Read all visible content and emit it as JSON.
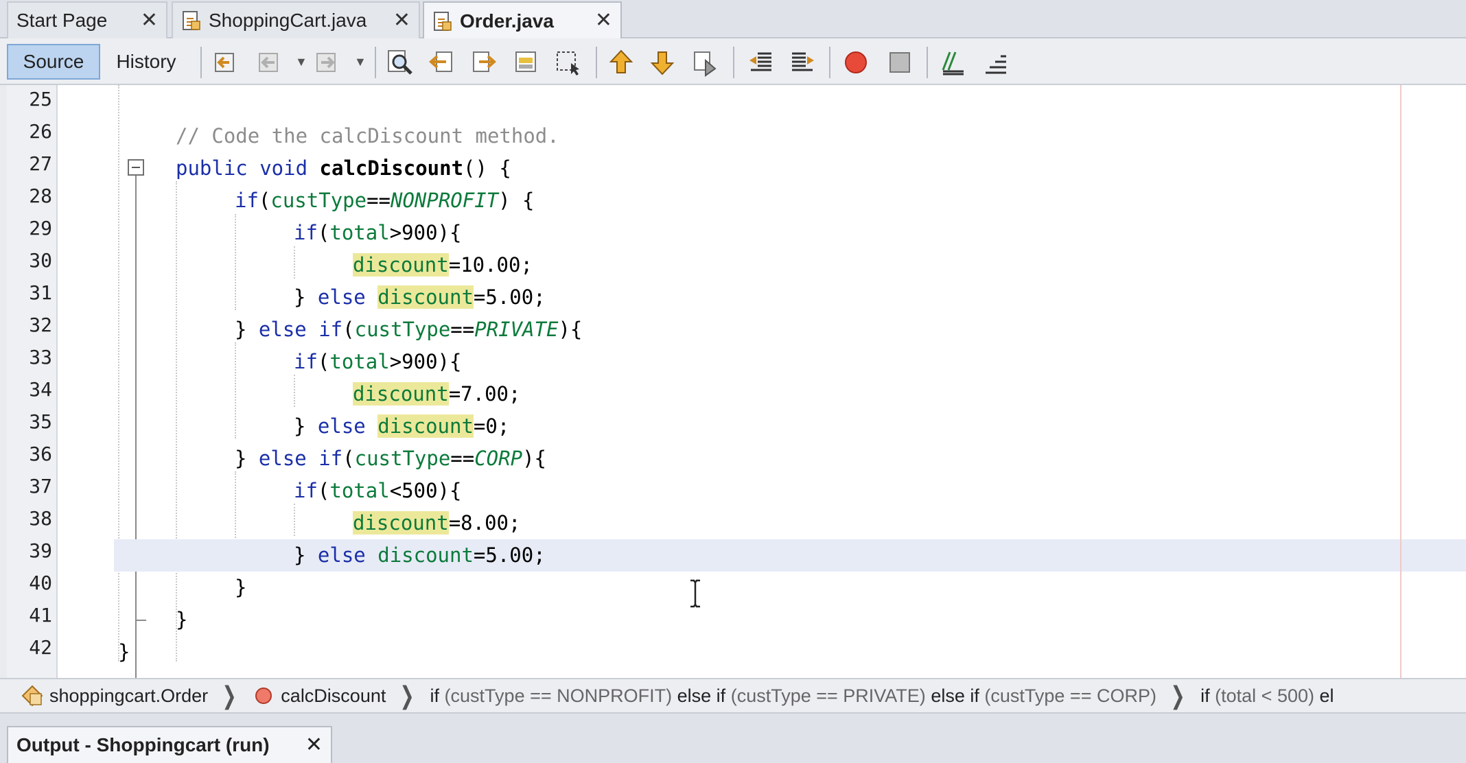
{
  "tabs": [
    {
      "label": "Start Page",
      "close": "✕",
      "icon": "none"
    },
    {
      "label": "ShoppingCart.java",
      "close": "✕",
      "icon": "java-file-icon"
    },
    {
      "label": "Order.java",
      "close": "✕",
      "icon": "java-file-icon",
      "active": true
    }
  ],
  "toolbar": {
    "source_label": "Source",
    "history_label": "History"
  },
  "editor": {
    "current_line": 39,
    "lines": [
      {
        "n": "25"
      },
      {
        "n": "26"
      },
      {
        "n": "27"
      },
      {
        "n": "28"
      },
      {
        "n": "29"
      },
      {
        "n": "30"
      },
      {
        "n": "31"
      },
      {
        "n": "32"
      },
      {
        "n": "33"
      },
      {
        "n": "34"
      },
      {
        "n": "35"
      },
      {
        "n": "36"
      },
      {
        "n": "37"
      },
      {
        "n": "38"
      },
      {
        "n": "39"
      },
      {
        "n": "40"
      },
      {
        "n": "41"
      },
      {
        "n": "42"
      }
    ],
    "code": {
      "c26": "// Code the calcDiscount method.",
      "c27_kw": "public void",
      "c27_name": "calcDiscount",
      "c27_rest": "() {",
      "c28_kw": "if",
      "c28_open": "(",
      "c28_var": "custType",
      "c28_op": "==",
      "c28_const": "NONPROFIT",
      "c28_close": ") {",
      "c29_kw": "if",
      "c29_open": "(",
      "c29_var": "total",
      "c29_rest": ">900){",
      "c30_var": "discount",
      "c30_rest": "=10.00;",
      "c31_pre": "} ",
      "c31_kw": "else",
      "c31_var": "discount",
      "c31_rest": "=5.00;",
      "c32_pre": "} ",
      "c32_kw": "else if",
      "c32_open": "(",
      "c32_var": "custType",
      "c32_op": "==",
      "c32_const": "PRIVATE",
      "c32_close": "){",
      "c33_kw": "if",
      "c33_open": "(",
      "c33_var": "total",
      "c33_rest": ">900){",
      "c34_var": "discount",
      "c34_rest": "=7.00;",
      "c35_pre": "} ",
      "c35_kw": "else",
      "c35_var": "discount",
      "c35_rest": "=0;",
      "c36_pre": "} ",
      "c36_kw": "else if",
      "c36_open": "(",
      "c36_var": "custType",
      "c36_op": "==",
      "c36_const": "CORP",
      "c36_close": "){",
      "c37_kw": "if",
      "c37_open": "(",
      "c37_var": "total",
      "c37_rest": "<500){",
      "c38_var": "discount",
      "c38_rest": "=8.00;",
      "c39_pre": "} ",
      "c39_kw": "else",
      "c39_var": "discount",
      "c39_rest": "=5.00;",
      "c40": "}",
      "c41": "}",
      "c42": "}"
    }
  },
  "breadcrumbs": {
    "class_label": "shoppingcart.Order",
    "method_label": "calcDiscount",
    "cond1_kw": "if",
    "cond1_expr": "(custType == NONPROFIT)",
    "cond2_kw": "else if",
    "cond2_expr": "(custType == PRIVATE)",
    "cond3_kw": "else if",
    "cond3_expr": "(custType == CORP)",
    "cond4_kw": "if",
    "cond4_expr": "(total < 500)",
    "cond5_kw": "el"
  },
  "output": {
    "tab_label": "Output - Shoppingcart (run)",
    "close": "✕"
  },
  "colors": {
    "keyword": "#1b2fa8",
    "field": "#0c7a3b",
    "comment": "#8c8c8c",
    "highlight": "#ece89a",
    "current_line": "#e7ebf6",
    "source_button": "#bcd4ef"
  }
}
